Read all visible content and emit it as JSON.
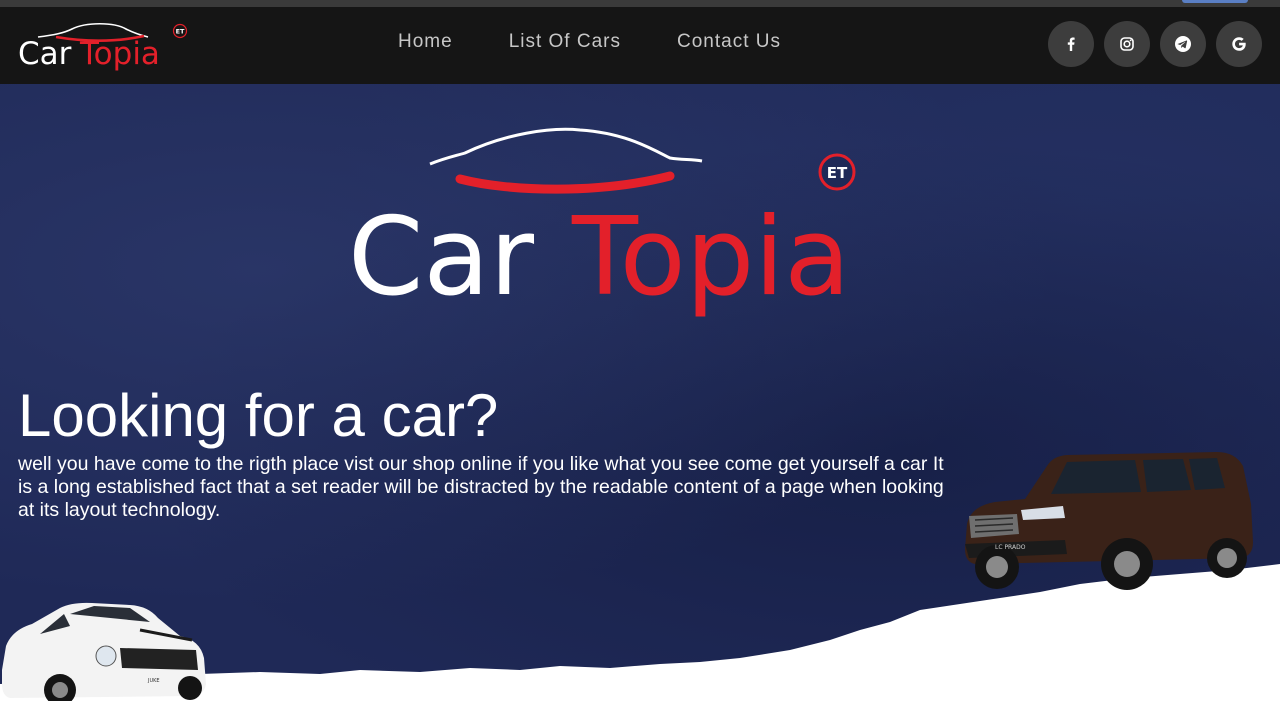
{
  "brand": {
    "name_part1": "Car",
    "name_part2": "Topia",
    "badge": "ET"
  },
  "nav": {
    "items": [
      {
        "label": "Home"
      },
      {
        "label": "List Of Cars"
      },
      {
        "label": "Contact Us"
      }
    ]
  },
  "socials": [
    {
      "icon": "facebook-icon",
      "glyph": "f"
    },
    {
      "icon": "instagram-icon"
    },
    {
      "icon": "telegram-icon"
    },
    {
      "icon": "google-icon",
      "glyph": "G"
    }
  ],
  "hero": {
    "headline": "Looking for a car?",
    "blurb": "well you have come to the rigth place vist our shop online if you like what you see come get yourself a car It is a long established fact that a set reader will be distracted by the readable content of a page when looking at its layout technology.",
    "left_car_badge": "JUKE",
    "right_car_badge": "LC PRADO"
  },
  "colors": {
    "navbar": "#151515",
    "hero_bg": "#1f2957",
    "brand_red": "#e3202a",
    "nav_text": "#c7c7c7",
    "social_bg": "#3d3d3d"
  }
}
